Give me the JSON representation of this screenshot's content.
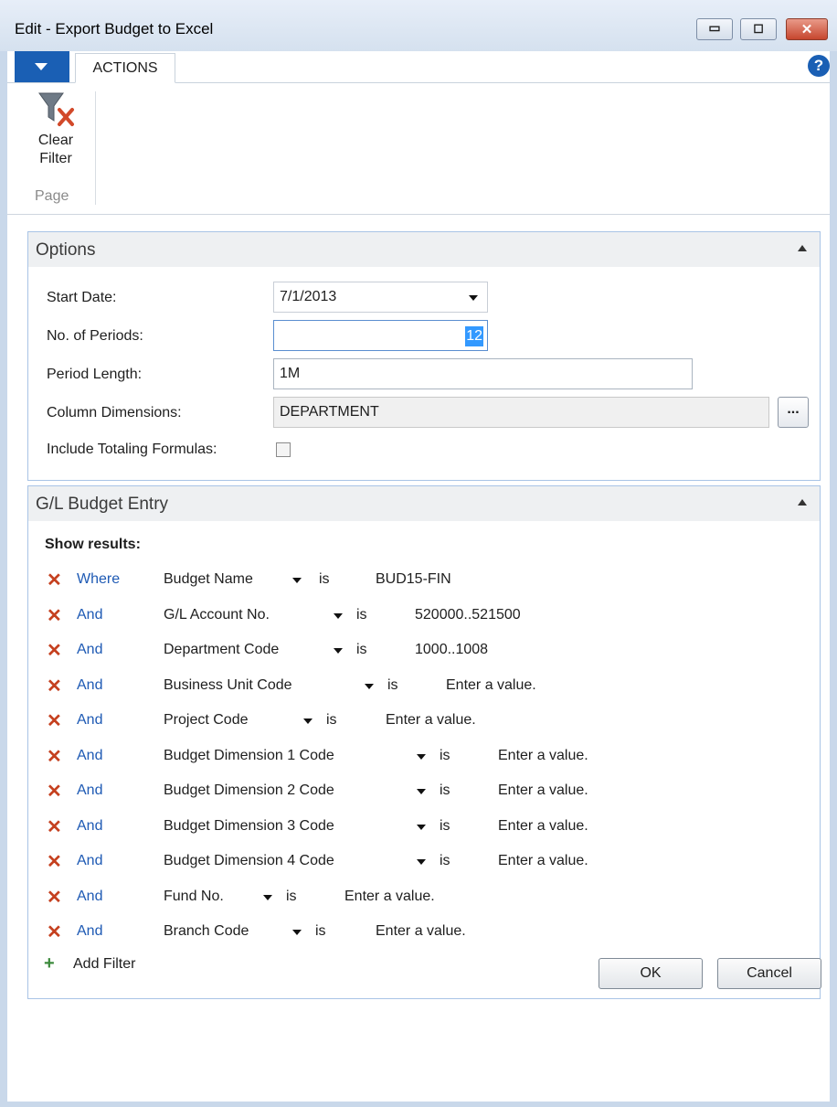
{
  "window": {
    "title": "Edit - Export Budget to Excel"
  },
  "window_buttons": {
    "minimize": "▭",
    "maximize": "◻",
    "close": "✕"
  },
  "ribbon": {
    "tab": "ACTIONS",
    "help": "?",
    "actions": [
      {
        "label_line1": "Clear",
        "label_line2": "Filter",
        "icon": "clear-filter-icon"
      }
    ],
    "group_label": "Page"
  },
  "options": {
    "title": "Options",
    "fields": {
      "start_date": {
        "label": "Start Date:",
        "value": "7/1/2013"
      },
      "no_of_periods": {
        "label": "No. of Periods:",
        "value": "12"
      },
      "period_length": {
        "label": "Period Length:",
        "value": "1M"
      },
      "column_dimensions": {
        "label": "Column Dimensions:",
        "value": "DEPARTMENT",
        "assist": "..."
      },
      "include_totaling_formulas": {
        "label": "Include Totaling Formulas:",
        "checked": false
      }
    }
  },
  "gl_budget_entry": {
    "title": "G/L Budget Entry",
    "show_results": "Show results:",
    "filters": [
      {
        "conj": "Where",
        "field": "Budget Name",
        "op": "is",
        "value": "BUD15-FIN"
      },
      {
        "conj": "And",
        "field": "G/L Account No.",
        "op": "is",
        "value": "520000..521500"
      },
      {
        "conj": "And",
        "field": "Department Code",
        "op": "is",
        "value": "1000..1008"
      },
      {
        "conj": "And",
        "field": "Business Unit Code",
        "op": "is",
        "value": "Enter a value."
      },
      {
        "conj": "And",
        "field": "Project Code",
        "op": "is",
        "value": "Enter a value."
      },
      {
        "conj": "And",
        "field": "Budget Dimension 1 Code",
        "op": "is",
        "value": "Enter a value."
      },
      {
        "conj": "And",
        "field": "Budget Dimension 2 Code",
        "op": "is",
        "value": "Enter a value."
      },
      {
        "conj": "And",
        "field": "Budget Dimension 3 Code",
        "op": "is",
        "value": "Enter a value."
      },
      {
        "conj": "And",
        "field": "Budget Dimension 4 Code",
        "op": "is",
        "value": "Enter a value."
      },
      {
        "conj": "And",
        "field": "Fund No.",
        "op": "is",
        "value": "Enter a value."
      },
      {
        "conj": "And",
        "field": "Branch Code",
        "op": "is",
        "value": "Enter a value."
      }
    ],
    "add_filter": "Add Filter"
  },
  "footer": {
    "ok": "OK",
    "cancel": "Cancel"
  },
  "colors": {
    "accent": "#1a5fb4",
    "remove": "#c5401f",
    "add": "#3c8a3c",
    "panel_border": "#a9c4e6"
  }
}
